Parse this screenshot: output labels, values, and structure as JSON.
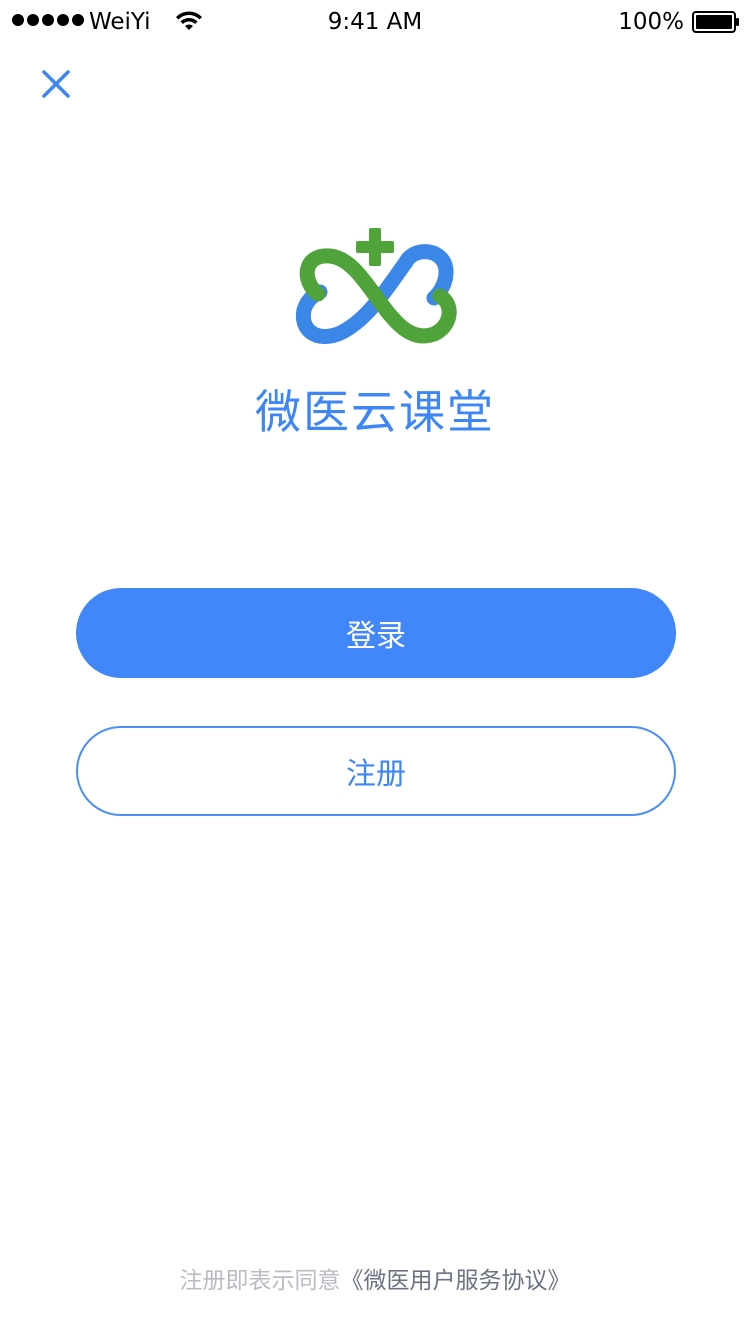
{
  "status_bar": {
    "carrier": "WeiYi",
    "time": "9:41 AM",
    "battery": "100%"
  },
  "close_icon": "close-icon",
  "logo": {
    "icon": "infinity-cross-logo",
    "colors": {
      "green": "#4fa33a",
      "blue": "#3b87e8"
    }
  },
  "brand": {
    "title": "微医云课堂"
  },
  "buttons": {
    "login_label": "登录",
    "register_label": "注册"
  },
  "footer": {
    "prefix": "注册即表示同意",
    "agreement_link": "《微医用户服务协议》"
  },
  "colors": {
    "accent": "#4287f9",
    "text_secondary": "#b9bcc3",
    "link": "#6b7282"
  }
}
